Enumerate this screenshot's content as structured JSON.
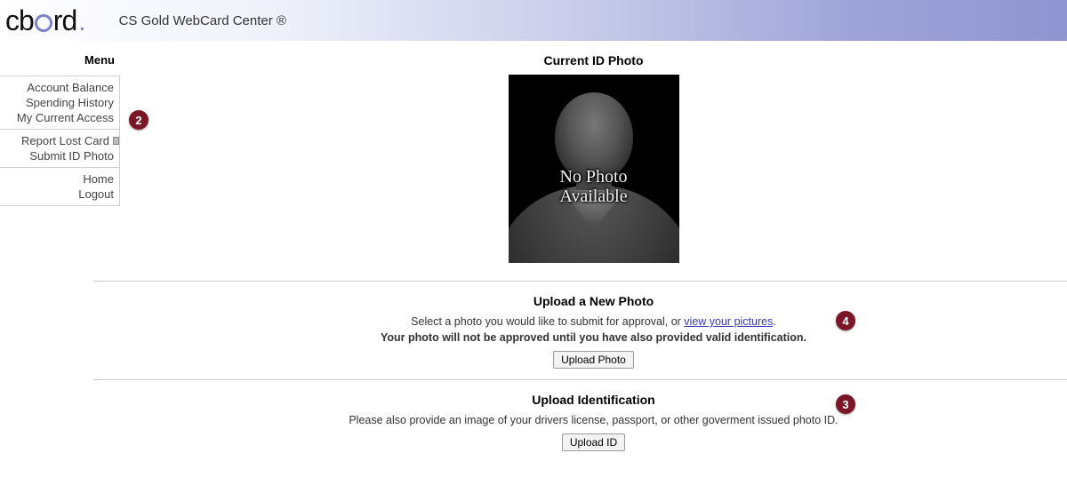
{
  "header": {
    "logo_text": "cbord",
    "app_title": "CS Gold WebCard Center ®"
  },
  "sidebar": {
    "title": "Menu",
    "group1": [
      "Account Balance",
      "Spending History",
      "My Current Access"
    ],
    "group2": [
      "Report Lost Card",
      "Submit ID Photo"
    ],
    "group3": [
      "Home",
      "Logout"
    ]
  },
  "current_photo": {
    "heading": "Current ID Photo",
    "placeholder_line1": "No Photo",
    "placeholder_line2": "Available"
  },
  "upload_photo": {
    "heading": "Upload a New Photo",
    "instruction_prefix": "Select a photo you would like to submit for approval, or ",
    "link_text": "view your pictures",
    "instruction_suffix": ".",
    "warning": "Your photo will not be approved until you have also provided valid identification.",
    "button": "Upload Photo"
  },
  "upload_id": {
    "heading": "Upload Identification",
    "instruction": "Please also provide an image of your drivers license, passport, or other goverment issued photo ID.",
    "button": "Upload ID"
  },
  "annotations": {
    "b2": "2",
    "b3": "3",
    "b4": "4"
  }
}
